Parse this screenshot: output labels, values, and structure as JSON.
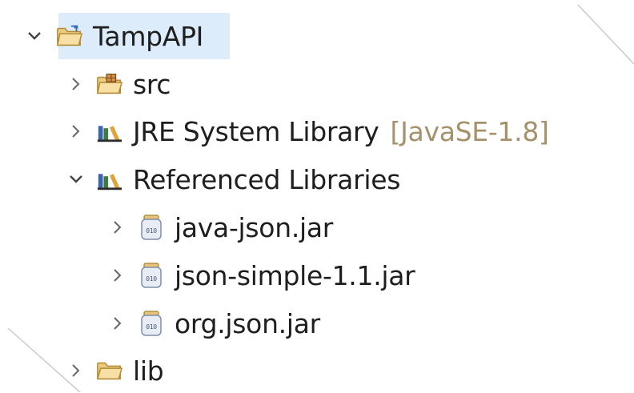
{
  "tree": {
    "project": {
      "label": "TampAPI",
      "expanded": true,
      "selected": true
    },
    "src": {
      "label": "src"
    },
    "jre": {
      "label": "JRE System Library",
      "decoration": "[JavaSE-1.8]"
    },
    "referenced": {
      "label": "Referenced Libraries",
      "expanded": true
    },
    "jars": [
      {
        "label": "java-json.jar"
      },
      {
        "label": "json-simple-1.1.jar"
      },
      {
        "label": "org.json.jar"
      }
    ],
    "lib": {
      "label": "lib"
    }
  },
  "icons": {
    "project": "project-folder-icon",
    "src": "package-folder-icon",
    "library": "library-books-icon",
    "jar": "jar-file-icon",
    "folder": "folder-icon"
  },
  "colors": {
    "selection": "#dcecfb",
    "decoration": "#a5926b",
    "text": "#1e1e1e",
    "folder": "#e9b651",
    "library_green": "#3f7a3f",
    "library_blue": "#3c63b0"
  }
}
